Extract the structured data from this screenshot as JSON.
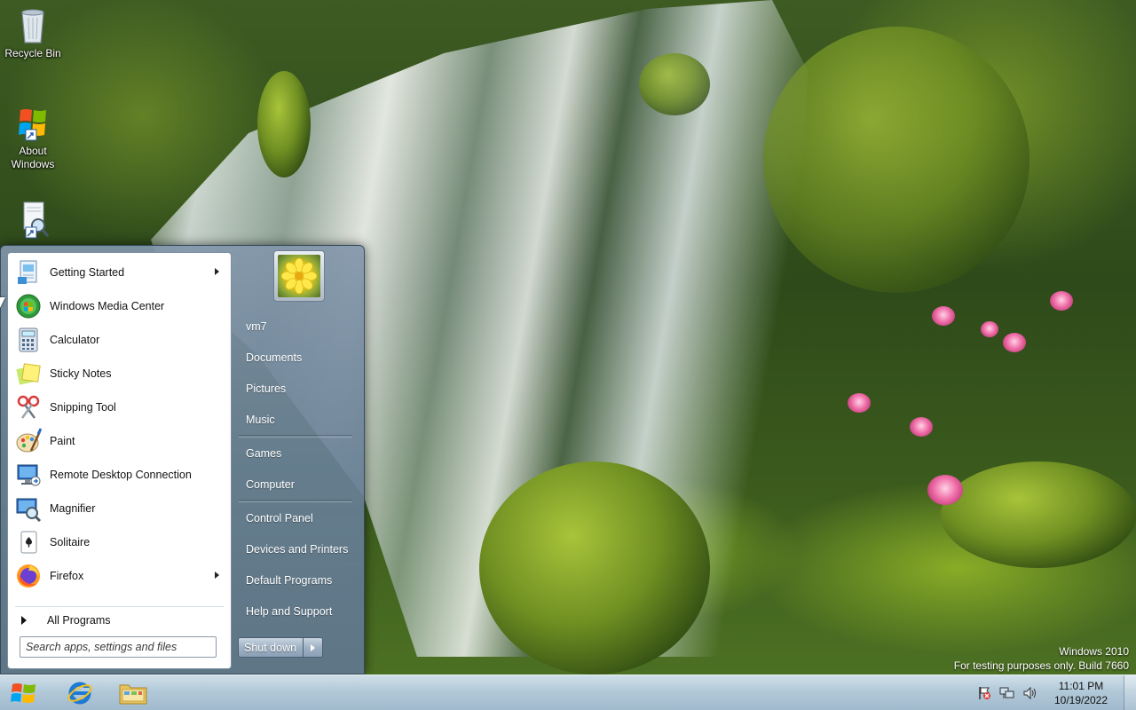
{
  "desktop": {
    "icons": [
      {
        "label": "Recycle Bin",
        "icon": "recycle-bin-icon"
      },
      {
        "label": "About Windows",
        "icon": "windows-flag-icon"
      },
      {
        "label": "",
        "icon": "magnifier-document-icon"
      }
    ],
    "watermark": {
      "line1": "Windows 2010",
      "line2": "For testing purposes only. Build 7660"
    }
  },
  "start_menu": {
    "programs": [
      {
        "label": "Getting Started",
        "icon": "getting-started-icon",
        "submenu": true
      },
      {
        "label": "Windows Media Center",
        "icon": "media-center-icon",
        "submenu": false
      },
      {
        "label": "Calculator",
        "icon": "calculator-icon",
        "submenu": false
      },
      {
        "label": "Sticky Notes",
        "icon": "sticky-notes-icon",
        "submenu": false
      },
      {
        "label": "Snipping Tool",
        "icon": "snipping-tool-icon",
        "submenu": false
      },
      {
        "label": "Paint",
        "icon": "paint-icon",
        "submenu": false
      },
      {
        "label": "Remote Desktop Connection",
        "icon": "remote-desktop-icon",
        "submenu": false
      },
      {
        "label": "Magnifier",
        "icon": "magnifier-icon",
        "submenu": false
      },
      {
        "label": "Solitaire",
        "icon": "solitaire-icon",
        "submenu": false
      },
      {
        "label": "Firefox",
        "icon": "firefox-icon",
        "submenu": true
      }
    ],
    "all_programs": "All Programs",
    "search_placeholder": "Search apps, settings and files",
    "user_name": "vm7",
    "places_group1": [
      "Documents",
      "Pictures",
      "Music"
    ],
    "places_group2": [
      "Games",
      "Computer"
    ],
    "places_group3": [
      "Control Panel",
      "Devices and Printers",
      "Default Programs",
      "Help and Support"
    ],
    "shutdown_label": "Shut down"
  },
  "taskbar": {
    "pinned": [
      {
        "name": "Internet Explorer",
        "icon": "internet-explorer-icon"
      },
      {
        "name": "Windows Explorer",
        "icon": "folder-icon"
      }
    ],
    "tray_icons": [
      "action-center-flag-icon",
      "network-icon",
      "volume-icon"
    ],
    "clock_time": "11:01 PM",
    "clock_date": "10/19/2022"
  },
  "colors": {
    "start_menu_glass": "#6f8aa5",
    "left_pane": "#ffffff",
    "taskbar": "#b7cde2"
  }
}
